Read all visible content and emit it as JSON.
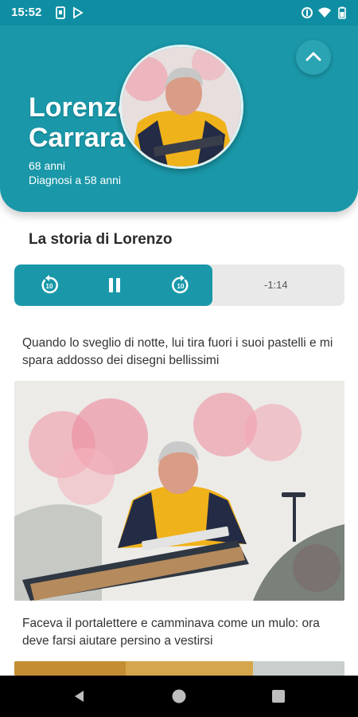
{
  "status_bar": {
    "time": "15:52"
  },
  "profile": {
    "first_name": "Lorenzo",
    "last_name": "Carrara",
    "age": "68 anni",
    "diagnosis": "Diagnosi a 58 anni"
  },
  "story": {
    "title": "La storia di Lorenzo",
    "remaining": "-1:14",
    "progress": 0.6
  },
  "captions": [
    "Quando lo sveglio di notte, lui tira fuori i suoi pastelli e mi spara addosso dei disegni bellissimi",
    "Faceva il portalettere e camminava come un mulo: ora deve farsi aiutare persino a vestirsi"
  ],
  "colors": {
    "accent": "#1a98a9",
    "status_bar": "#0f8ea3",
    "player_track": "#e9e9e9"
  },
  "icons": {
    "status": [
      "sim-card-icon",
      "play-store-icon",
      "data-saver-icon",
      "wifi-icon",
      "battery-icon"
    ],
    "player": [
      "rewind-10-icon",
      "pause-icon",
      "forward-10-icon"
    ],
    "nav": [
      "back-icon",
      "home-icon",
      "recents-icon"
    ]
  }
}
